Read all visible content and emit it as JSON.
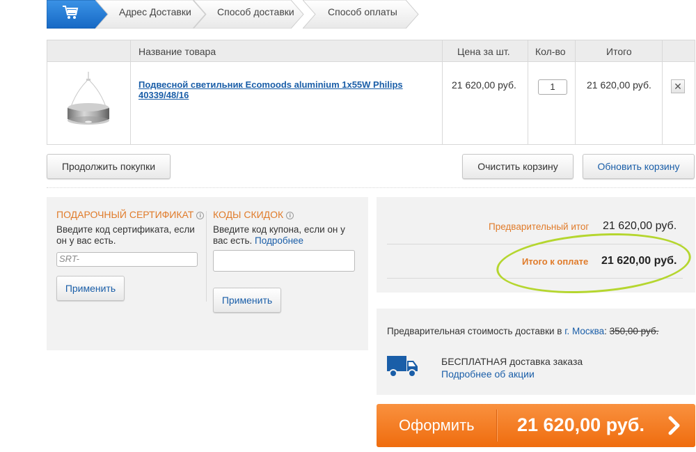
{
  "steps": [
    "Адрес Доставки",
    "Способ доставки",
    "Способ оплаты"
  ],
  "table": {
    "headers": {
      "name": "Название товара",
      "price": "Цена за шт.",
      "qty": "Кол-во",
      "total": "Итого"
    },
    "rows": [
      {
        "name": "Подвесной светильник Ecomoods aluminium 1x55W Philips 40339/48/16",
        "price": "21 620,00 руб.",
        "qty": "1",
        "total": "21 620,00 руб.",
        "remove": "✕"
      }
    ]
  },
  "buttons": {
    "continue": "Продолжить покупки",
    "clear": "Очистить корзину",
    "update": "Обновить корзину"
  },
  "gift": {
    "title": "ПОДАРОЧНЫЙ СЕРТИФИКАТ",
    "text": "Введите код сертификата, если он у вас есть.",
    "placeholder": "SRT-",
    "apply": "Применить"
  },
  "discount": {
    "title": "КОДЫ СКИДОК",
    "text": "Введите код купона, если он у вас есть.",
    "more": "Подробнее",
    "apply": "Применить"
  },
  "totals": {
    "subtotal_label": "Предварительный итог",
    "subtotal_value": "21 620,00 руб.",
    "grand_label": "Итого к оплате",
    "grand_value": "21 620,00 руб."
  },
  "delivery": {
    "prefix": "Предварительная стоимость доставки в",
    "city_label": "г. Москва",
    "old_price": "350,00 руб.",
    "free_text": "БЕСПЛАТНАЯ доставка заказа",
    "free_more": "Подробнее об акции"
  },
  "checkout": {
    "label": "Оформить",
    "total": "21 620,00 руб."
  },
  "colors": {
    "accent_orange": "#ef6c0e",
    "link_blue": "#1a5ea8",
    "step_active": "#1a7bd8",
    "highlight_green": "#b5d62f"
  },
  "icons": [
    "cart-icon",
    "info-icon",
    "close-icon",
    "truck-icon",
    "chevron-right-icon"
  ]
}
